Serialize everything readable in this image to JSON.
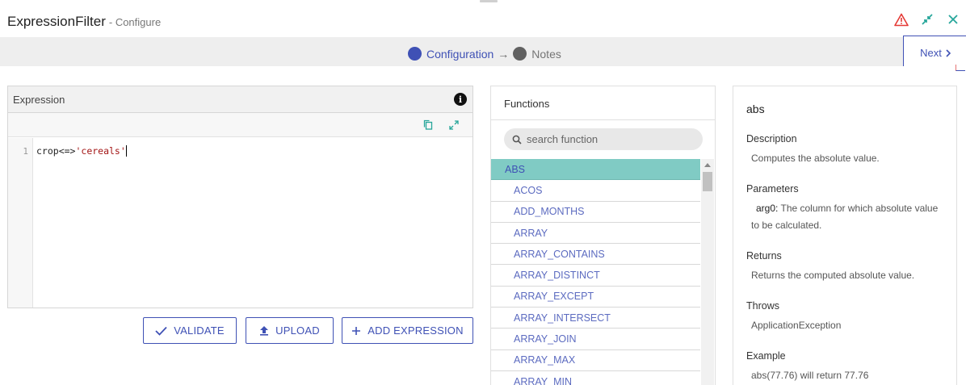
{
  "header": {
    "title": "ExpressionFilter",
    "subtitle": "- Configure"
  },
  "colors": {
    "accent": "#3f51b5",
    "selected": "#80cbc4",
    "warning": "#e53935",
    "teal": "#26a69a"
  },
  "stepper": {
    "steps": [
      {
        "label": "Configuration",
        "state": "active"
      },
      {
        "label": "Notes",
        "state": "inactive"
      }
    ],
    "arrow": "→",
    "next_label": "Next"
  },
  "expression": {
    "title": "Expression",
    "line_number": "1",
    "code_prefix": "crop<=>",
    "code_string": "'cereals'"
  },
  "actions": {
    "validate": "VALIDATE",
    "upload": "UPLOAD",
    "add_expression": "ADD EXPRESSION"
  },
  "functions": {
    "title": "Functions",
    "search_placeholder": "search function",
    "items": [
      "ABS",
      "ACOS",
      "ADD_MONTHS",
      "ARRAY",
      "ARRAY_CONTAINS",
      "ARRAY_DISTINCT",
      "ARRAY_EXCEPT",
      "ARRAY_INTERSECT",
      "ARRAY_JOIN",
      "ARRAY_MAX",
      "ARRAY_MIN"
    ],
    "selected_index": 0
  },
  "details": {
    "name": "abs",
    "description_label": "Description",
    "description": "Computes the absolute value.",
    "parameters_label": "Parameters",
    "param_name": "arg0:",
    "param_desc": "The column for which absolute value to be calculated.",
    "returns_label": "Returns",
    "returns": "Returns the computed absolute value.",
    "throws_label": "Throws",
    "throws": "ApplicationException",
    "example_label": "Example",
    "example": "abs(77.76) will return 77.76"
  }
}
